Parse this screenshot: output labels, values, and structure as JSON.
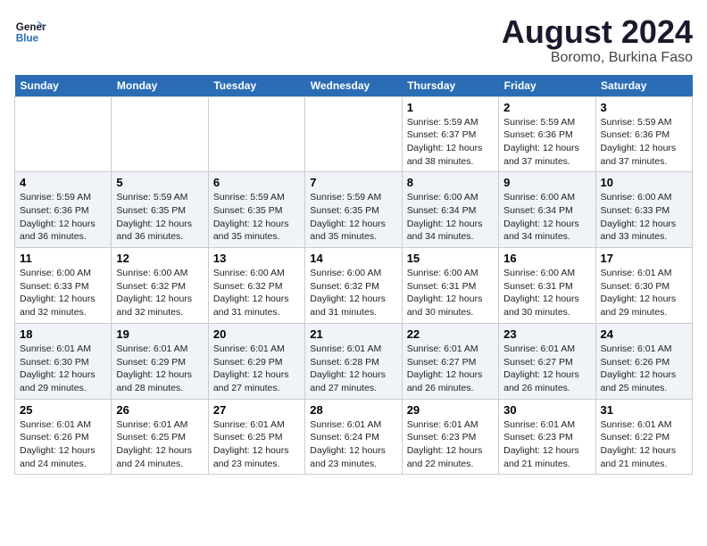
{
  "header": {
    "logo_line1": "General",
    "logo_line2": "Blue",
    "month": "August 2024",
    "location": "Boromo, Burkina Faso"
  },
  "weekdays": [
    "Sunday",
    "Monday",
    "Tuesday",
    "Wednesday",
    "Thursday",
    "Friday",
    "Saturday"
  ],
  "weeks": [
    [
      {
        "day": "",
        "detail": ""
      },
      {
        "day": "",
        "detail": ""
      },
      {
        "day": "",
        "detail": ""
      },
      {
        "day": "",
        "detail": ""
      },
      {
        "day": "1",
        "detail": "Sunrise: 5:59 AM\nSunset: 6:37 PM\nDaylight: 12 hours\nand 38 minutes."
      },
      {
        "day": "2",
        "detail": "Sunrise: 5:59 AM\nSunset: 6:36 PM\nDaylight: 12 hours\nand 37 minutes."
      },
      {
        "day": "3",
        "detail": "Sunrise: 5:59 AM\nSunset: 6:36 PM\nDaylight: 12 hours\nand 37 minutes."
      }
    ],
    [
      {
        "day": "4",
        "detail": "Sunrise: 5:59 AM\nSunset: 6:36 PM\nDaylight: 12 hours\nand 36 minutes."
      },
      {
        "day": "5",
        "detail": "Sunrise: 5:59 AM\nSunset: 6:35 PM\nDaylight: 12 hours\nand 36 minutes."
      },
      {
        "day": "6",
        "detail": "Sunrise: 5:59 AM\nSunset: 6:35 PM\nDaylight: 12 hours\nand 35 minutes."
      },
      {
        "day": "7",
        "detail": "Sunrise: 5:59 AM\nSunset: 6:35 PM\nDaylight: 12 hours\nand 35 minutes."
      },
      {
        "day": "8",
        "detail": "Sunrise: 6:00 AM\nSunset: 6:34 PM\nDaylight: 12 hours\nand 34 minutes."
      },
      {
        "day": "9",
        "detail": "Sunrise: 6:00 AM\nSunset: 6:34 PM\nDaylight: 12 hours\nand 34 minutes."
      },
      {
        "day": "10",
        "detail": "Sunrise: 6:00 AM\nSunset: 6:33 PM\nDaylight: 12 hours\nand 33 minutes."
      }
    ],
    [
      {
        "day": "11",
        "detail": "Sunrise: 6:00 AM\nSunset: 6:33 PM\nDaylight: 12 hours\nand 32 minutes."
      },
      {
        "day": "12",
        "detail": "Sunrise: 6:00 AM\nSunset: 6:32 PM\nDaylight: 12 hours\nand 32 minutes."
      },
      {
        "day": "13",
        "detail": "Sunrise: 6:00 AM\nSunset: 6:32 PM\nDaylight: 12 hours\nand 31 minutes."
      },
      {
        "day": "14",
        "detail": "Sunrise: 6:00 AM\nSunset: 6:32 PM\nDaylight: 12 hours\nand 31 minutes."
      },
      {
        "day": "15",
        "detail": "Sunrise: 6:00 AM\nSunset: 6:31 PM\nDaylight: 12 hours\nand 30 minutes."
      },
      {
        "day": "16",
        "detail": "Sunrise: 6:00 AM\nSunset: 6:31 PM\nDaylight: 12 hours\nand 30 minutes."
      },
      {
        "day": "17",
        "detail": "Sunrise: 6:01 AM\nSunset: 6:30 PM\nDaylight: 12 hours\nand 29 minutes."
      }
    ],
    [
      {
        "day": "18",
        "detail": "Sunrise: 6:01 AM\nSunset: 6:30 PM\nDaylight: 12 hours\nand 29 minutes."
      },
      {
        "day": "19",
        "detail": "Sunrise: 6:01 AM\nSunset: 6:29 PM\nDaylight: 12 hours\nand 28 minutes."
      },
      {
        "day": "20",
        "detail": "Sunrise: 6:01 AM\nSunset: 6:29 PM\nDaylight: 12 hours\nand 27 minutes."
      },
      {
        "day": "21",
        "detail": "Sunrise: 6:01 AM\nSunset: 6:28 PM\nDaylight: 12 hours\nand 27 minutes."
      },
      {
        "day": "22",
        "detail": "Sunrise: 6:01 AM\nSunset: 6:27 PM\nDaylight: 12 hours\nand 26 minutes."
      },
      {
        "day": "23",
        "detail": "Sunrise: 6:01 AM\nSunset: 6:27 PM\nDaylight: 12 hours\nand 26 minutes."
      },
      {
        "day": "24",
        "detail": "Sunrise: 6:01 AM\nSunset: 6:26 PM\nDaylight: 12 hours\nand 25 minutes."
      }
    ],
    [
      {
        "day": "25",
        "detail": "Sunrise: 6:01 AM\nSunset: 6:26 PM\nDaylight: 12 hours\nand 24 minutes."
      },
      {
        "day": "26",
        "detail": "Sunrise: 6:01 AM\nSunset: 6:25 PM\nDaylight: 12 hours\nand 24 minutes."
      },
      {
        "day": "27",
        "detail": "Sunrise: 6:01 AM\nSunset: 6:25 PM\nDaylight: 12 hours\nand 23 minutes."
      },
      {
        "day": "28",
        "detail": "Sunrise: 6:01 AM\nSunset: 6:24 PM\nDaylight: 12 hours\nand 23 minutes."
      },
      {
        "day": "29",
        "detail": "Sunrise: 6:01 AM\nSunset: 6:23 PM\nDaylight: 12 hours\nand 22 minutes."
      },
      {
        "day": "30",
        "detail": "Sunrise: 6:01 AM\nSunset: 6:23 PM\nDaylight: 12 hours\nand 21 minutes."
      },
      {
        "day": "31",
        "detail": "Sunrise: 6:01 AM\nSunset: 6:22 PM\nDaylight: 12 hours\nand 21 minutes."
      }
    ]
  ]
}
